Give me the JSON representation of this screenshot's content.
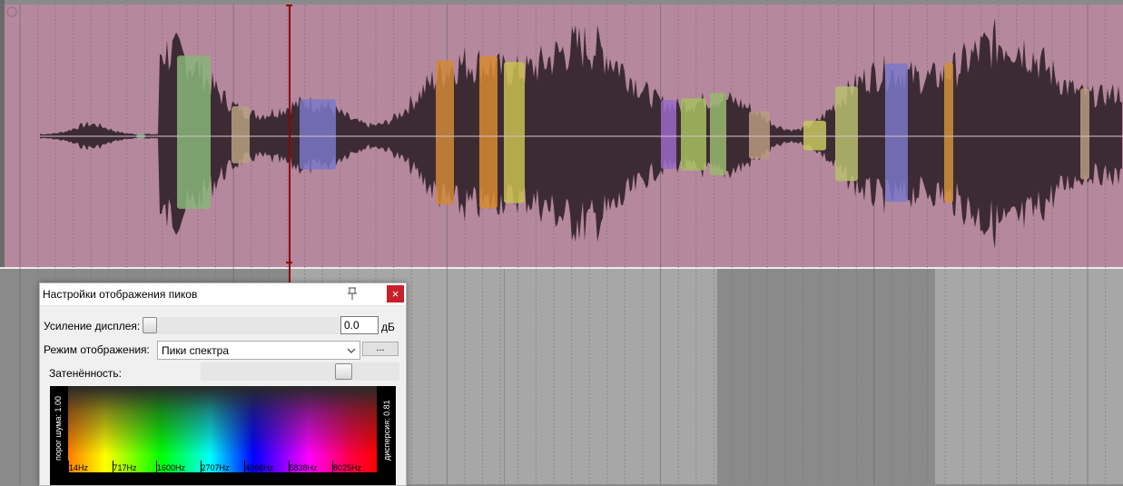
{
  "colors": {
    "track_bg": "#b5889d",
    "lower_bg": "#8a8a8a",
    "lower_bg_light": "#a7a7a7",
    "waveform_dark": "#3d2b33",
    "playhead": "#8b0000",
    "dialog_bg": "#f0f0f0"
  },
  "dialog": {
    "title": "Настройки отображения пиков",
    "pin_icon": "pin-icon",
    "close_label": "×",
    "gain_label": "Усиление дисплея:",
    "gain_value": "0.0",
    "gain_unit": "дБ",
    "mode_label": "Режим отображения:",
    "mode_value": "Пики спектра",
    "more_label": "...",
    "shade_label": "Затенённость:",
    "shade_level": 0.81,
    "noise_label": "порог шума: 1.00",
    "dispersion_label": "дисперсия: 0.81",
    "freq_labels": [
      "14Hz",
      "717Hz",
      "1600Hz",
      "2707Hz",
      "4066Hz",
      "5838Hz",
      "8025Hz"
    ]
  }
}
